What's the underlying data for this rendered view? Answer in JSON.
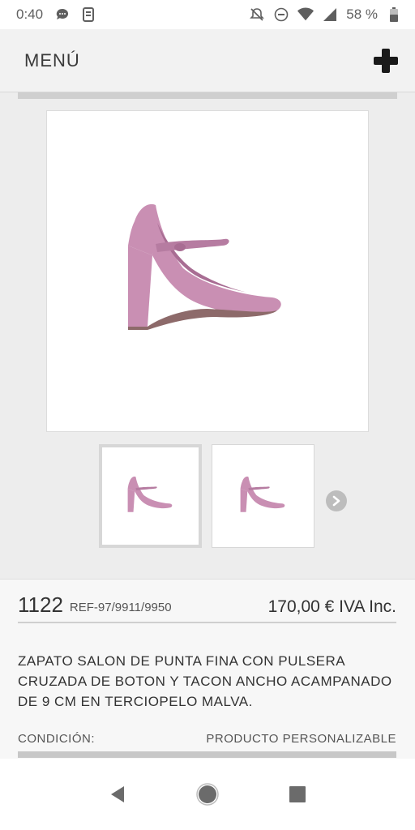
{
  "status": {
    "time": "0:40",
    "battery": "58 %",
    "icons": [
      "chat-bubble-icon",
      "phone-sim-icon",
      "notifications-off-icon",
      "do-not-disturb-icon",
      "wifi-icon",
      "signal-icon",
      "battery-icon"
    ]
  },
  "header": {
    "menu_label": "MENÚ",
    "action_icon": "plus-icon"
  },
  "gallery": {
    "main_image": "pink-velvet-mary-jane-pump",
    "thumbnails": [
      "pink-velvet-pump-side",
      "pink-velvet-pump-angle"
    ],
    "next_icon": "chevron-right-icon"
  },
  "product": {
    "code": "1122",
    "ref": "REF-97/9911/9950",
    "price": "170,00 € IVA Inc.",
    "description": "ZAPATO SALON DE PUNTA FINA CON PULSERA CRUZADA DE BOTON Y TACON ANCHO ACAMPANADO DE 9 CM EN TERCIOPELO MALVA.",
    "condition_label": "CONDICIÓN:",
    "condition_value": "PRODUCTO PERSONALIZABLE"
  },
  "navbar": {
    "icons": [
      "back-icon",
      "home-icon",
      "recents-icon"
    ]
  },
  "colors": {
    "shoe": "#c98fb3",
    "shoe_dark": "#a86d93",
    "arrow_bg": "#bdbdbd"
  }
}
